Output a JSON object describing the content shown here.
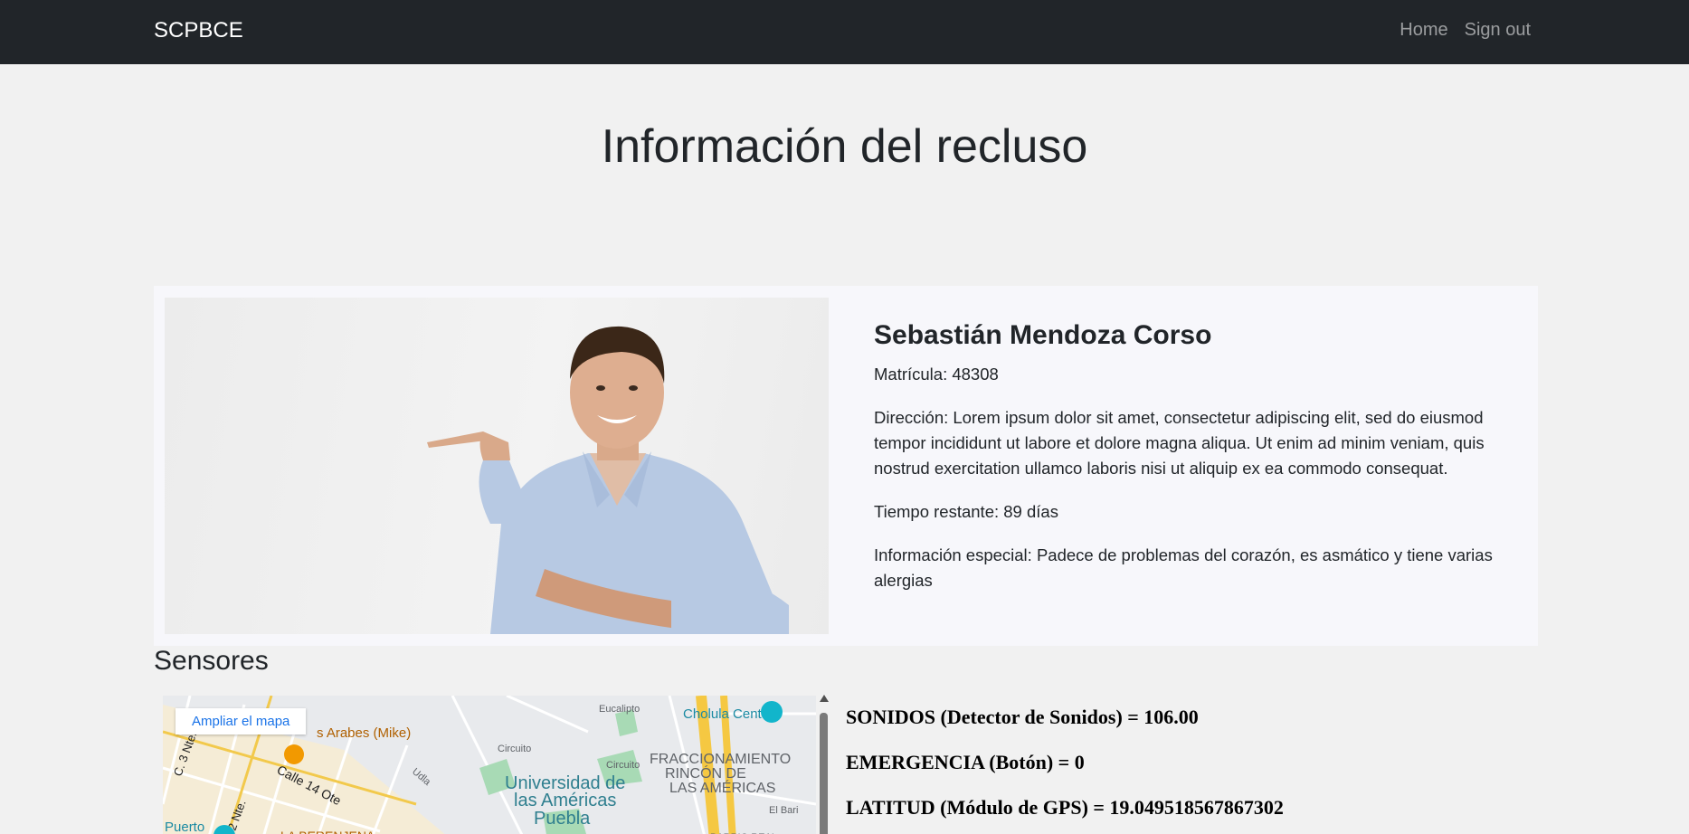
{
  "nav": {
    "brand": "SCPBCE",
    "links": [
      "Home",
      "Sign out"
    ]
  },
  "page": {
    "title": "Información del recluso"
  },
  "inmate": {
    "name": "Sebastián Mendoza Corso",
    "matricula": "Matrícula: 48308",
    "direccion": "Dirección: Lorem ipsum dolor sit amet, consectetur adipiscing elit, sed do eiusmod tempor incididunt ut labore et dolore magna aliqua. Ut enim ad minim veniam, quis nostrud exercitation ullamco laboris nisi ut aliquip ex ea commodo consequat.",
    "tiempo": "Tiempo restante: 89 días",
    "especial": "Información especial: Padece de problemas del corazón, es asmático y tiene varias alergias"
  },
  "sensors": {
    "heading": "Sensores",
    "map": {
      "expand_label": "Ampliar el mapa",
      "labels": [
        "Eucalipto",
        "Cholula Center",
        "Circuito",
        "Circuito",
        "FRACCIONAMIENTO",
        "RINCÓN DE",
        "LAS AMÉRICAS",
        "Universidad de",
        "las Américas",
        "Puebla",
        "Calle 14 Ote",
        "C. 3 Nte.",
        "2 Nte.",
        "s Arabes (Mike)",
        "Puerto",
        "LA BERENJENA",
        "El Bari",
        "BARRIO REAL",
        "Udla"
      ]
    },
    "readings": [
      "SONIDOS (Detector de Sonidos) = 106.00",
      "EMERGENCIA (Botón) = 0",
      "LATITUD (Módulo de GPS) = 19.049518567867302"
    ]
  }
}
